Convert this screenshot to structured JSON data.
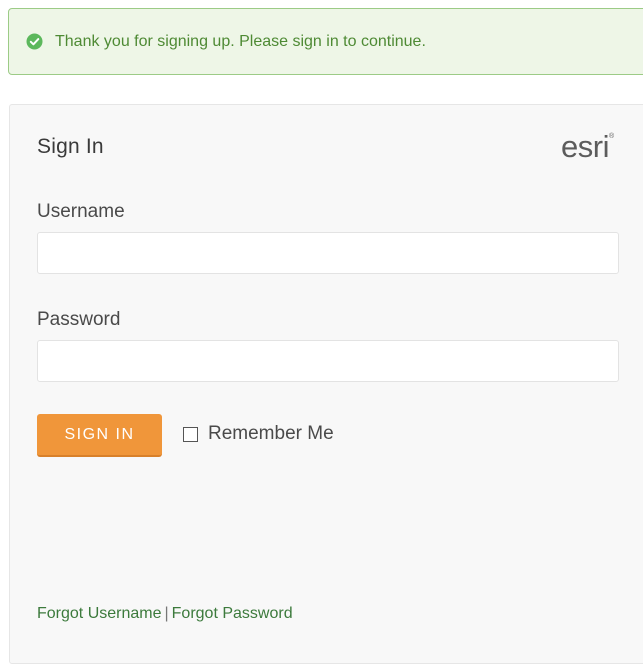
{
  "alert": {
    "message": "Thank you for signing up. Please sign in to continue.",
    "icon": "check-circle-icon",
    "color": "#4e8a34"
  },
  "signin": {
    "title": "Sign In",
    "logo_text": "esri",
    "logo_mark": "®",
    "username_label": "Username",
    "username_value": "",
    "password_label": "Password",
    "password_value": "",
    "button_label": "SIGN IN",
    "remember_label": "Remember Me",
    "remember_checked": false,
    "accent_color": "#f0963a"
  },
  "footer": {
    "forgot_username": "Forgot Username",
    "separator": "|",
    "forgot_password": "Forgot Password"
  }
}
